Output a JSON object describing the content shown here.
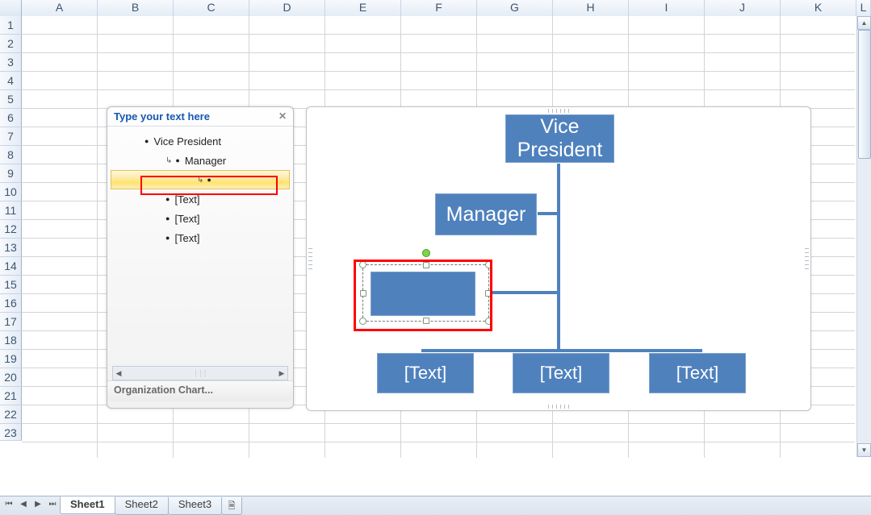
{
  "columns": [
    "A",
    "B",
    "C",
    "D",
    "E",
    "F",
    "G",
    "H",
    "I",
    "J",
    "K",
    "L"
  ],
  "rows": [
    "1",
    "2",
    "3",
    "4",
    "5",
    "6",
    "7",
    "8",
    "9",
    "10",
    "11",
    "12",
    "13",
    "14",
    "15",
    "16",
    "17",
    "18",
    "19",
    "20",
    "21",
    "22",
    "23"
  ],
  "text_pane": {
    "title": "Type your text here",
    "items": [
      {
        "level": 0,
        "text": "Vice President",
        "bullet": true
      },
      {
        "level": 1,
        "text": "Manager",
        "arrow": true
      },
      {
        "level": 2,
        "text": "",
        "arrow": true,
        "selected": true
      },
      {
        "level": 1,
        "text": "[Text]",
        "bullet": true
      },
      {
        "level": 1,
        "text": "[Text]",
        "bullet": true
      },
      {
        "level": 1,
        "text": "[Text]",
        "bullet": true
      }
    ],
    "footer": "Organization Chart..."
  },
  "smartart": {
    "top_node": "Vice\nPresident",
    "manager_node": "Manager",
    "bottom_nodes": [
      "[Text]",
      "[Text]",
      "[Text]"
    ]
  },
  "sheets": {
    "active": "Sheet1",
    "tabs": [
      "Sheet1",
      "Sheet2",
      "Sheet3"
    ]
  }
}
